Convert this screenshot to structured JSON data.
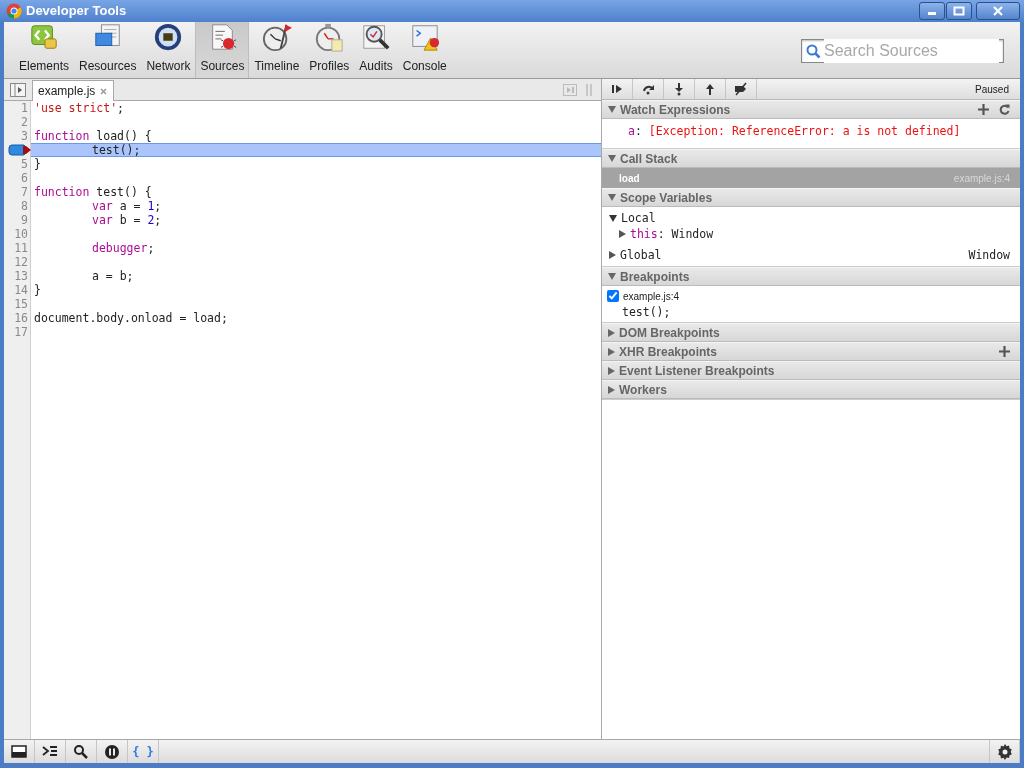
{
  "window": {
    "title": "Developer Tools"
  },
  "toolbar": {
    "tabs": [
      {
        "label": "Elements",
        "selected": false
      },
      {
        "label": "Resources",
        "selected": false
      },
      {
        "label": "Network",
        "selected": false
      },
      {
        "label": "Sources",
        "selected": true
      },
      {
        "label": "Timeline",
        "selected": false
      },
      {
        "label": "Profiles",
        "selected": false
      },
      {
        "label": "Audits",
        "selected": false
      },
      {
        "label": "Console",
        "selected": false
      }
    ],
    "search": {
      "placeholder": "Search Sources"
    }
  },
  "editor": {
    "tabs": [
      {
        "label": "example.js",
        "selected": true
      }
    ],
    "lines": [
      {
        "number": "1",
        "breakpoint": false,
        "current": false,
        "indented": false,
        "tokens": [
          {
            "text": "'use strict'",
            "kind": "string"
          },
          {
            "text": ";",
            "kind": "plain"
          }
        ]
      },
      {
        "number": "2",
        "breakpoint": false,
        "current": false,
        "indented": false
      },
      {
        "number": "3",
        "breakpoint": false,
        "current": false,
        "indented": false,
        "tokens": [
          {
            "text": "function",
            "kind": "keyword"
          },
          {
            "text": " load() {",
            "kind": "plain"
          }
        ]
      },
      {
        "breakpoint": true,
        "current": true,
        "indented": true,
        "tokens": [
          {
            "text": "test();",
            "kind": "plain"
          }
        ]
      },
      {
        "number": "5",
        "breakpoint": false,
        "current": false,
        "indented": false,
        "tokens": [
          {
            "text": "}",
            "kind": "plain"
          }
        ]
      },
      {
        "number": "6",
        "breakpoint": false,
        "current": false,
        "indented": false
      },
      {
        "number": "7",
        "breakpoint": false,
        "current": false,
        "indented": false,
        "tokens": [
          {
            "text": "function",
            "kind": "keyword"
          },
          {
            "text": " test() {",
            "kind": "plain"
          }
        ]
      },
      {
        "number": "8",
        "breakpoint": false,
        "current": false,
        "indented": true,
        "tokens": [
          {
            "text": "var",
            "kind": "keyword"
          },
          {
            "text": " a = ",
            "kind": "plain"
          },
          {
            "text": "1",
            "kind": "number"
          },
          {
            "text": ";",
            "kind": "plain"
          }
        ]
      },
      {
        "number": "9",
        "breakpoint": false,
        "current": false,
        "indented": true,
        "tokens": [
          {
            "text": "var",
            "kind": "keyword"
          },
          {
            "text": " b = ",
            "kind": "plain"
          },
          {
            "text": "2",
            "kind": "number"
          },
          {
            "text": ";",
            "kind": "plain"
          }
        ]
      },
      {
        "number": "10",
        "breakpoint": false,
        "current": false,
        "indented": false
      },
      {
        "number": "11",
        "breakpoint": false,
        "current": false,
        "indented": true,
        "tokens": [
          {
            "text": "debugger",
            "kind": "keyword"
          },
          {
            "text": ";",
            "kind": "plain"
          }
        ]
      },
      {
        "number": "12",
        "breakpoint": false,
        "current": false,
        "indented": false
      },
      {
        "number": "13",
        "breakpoint": false,
        "current": false,
        "indented": true,
        "tokens": [
          {
            "text": "a = b;",
            "kind": "plain"
          }
        ]
      },
      {
        "number": "14",
        "breakpoint": false,
        "current": false,
        "indented": false,
        "tokens": [
          {
            "text": "}",
            "kind": "plain"
          }
        ]
      },
      {
        "number": "15",
        "breakpoint": false,
        "current": false,
        "indented": false
      },
      {
        "number": "16",
        "breakpoint": false,
        "current": false,
        "indented": false,
        "tokens": [
          {
            "text": "document.body.onload = load;",
            "kind": "plain"
          }
        ]
      },
      {
        "number": "17",
        "breakpoint": false,
        "current": false,
        "indented": false
      }
    ]
  },
  "debugger": {
    "status": "Paused",
    "sections": [
      {
        "kind": "watch",
        "title": "Watch Expressions",
        "expanded": true,
        "add_button": true,
        "refresh_button": true,
        "items": [
          {
            "name": "a",
            "separator": ":",
            "value": "[Exception: ReferenceError: a is not defined]"
          }
        ]
      },
      {
        "kind": "callstack",
        "title": "Call Stack",
        "expanded": true,
        "add_button": false,
        "refresh_button": false,
        "frames": [
          {
            "name": "load",
            "location": "example.js:4",
            "selected": true
          }
        ]
      },
      {
        "kind": "scope",
        "title": "Scope Variables",
        "expanded": true,
        "add_button": false,
        "refresh_button": false,
        "scopes": [
          {
            "name": "Local",
            "expanded": true,
            "children": [
              {
                "name": "this",
                "separator": ":",
                "value": "Window",
                "expanded": false
              }
            ]
          },
          {
            "name": "Global",
            "expanded": false,
            "value": "Window"
          }
        ]
      },
      {
        "kind": "breakpoints",
        "title": "Breakpoints",
        "expanded": true,
        "add_button": false,
        "refresh_button": false,
        "items": [
          {
            "location": "example.js:4",
            "code": "test();",
            "checked": true
          }
        ]
      },
      {
        "title": "DOM Breakpoints",
        "expanded": false,
        "add_button": false,
        "refresh_button": false
      },
      {
        "title": "XHR Breakpoints",
        "expanded": false,
        "add_button": true,
        "refresh_button": false
      },
      {
        "title": "Event Listener Breakpoints",
        "expanded": false,
        "add_button": false,
        "refresh_button": false
      },
      {
        "title": "Workers",
        "expanded": false,
        "add_button": false,
        "refresh_button": false
      }
    ]
  },
  "status_bar": {
    "pretty_print": "{ }"
  }
}
